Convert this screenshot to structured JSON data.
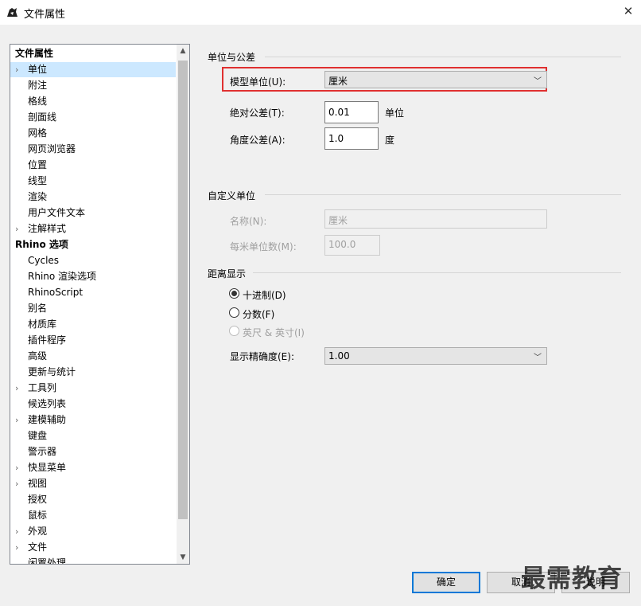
{
  "window": {
    "title": "文件属性",
    "close_glyph": "✕"
  },
  "tree": {
    "items": [
      {
        "label": "文件属性",
        "bold": true,
        "level": 0,
        "expander": false
      },
      {
        "label": "单位",
        "level": 1,
        "expander": true,
        "selected": true
      },
      {
        "label": "附注",
        "level": 1,
        "expander": false
      },
      {
        "label": "格线",
        "level": 1,
        "expander": false
      },
      {
        "label": "剖面线",
        "level": 1,
        "expander": false
      },
      {
        "label": "网格",
        "level": 1,
        "expander": false
      },
      {
        "label": "网页浏览器",
        "level": 1,
        "expander": false
      },
      {
        "label": "位置",
        "level": 1,
        "expander": false
      },
      {
        "label": "线型",
        "level": 1,
        "expander": false
      },
      {
        "label": "渲染",
        "level": 1,
        "expander": false
      },
      {
        "label": "用户文件文本",
        "level": 1,
        "expander": false
      },
      {
        "label": "注解样式",
        "level": 1,
        "expander": true
      },
      {
        "label": "Rhino 选项",
        "bold": true,
        "level": 0,
        "expander": false
      },
      {
        "label": "Cycles",
        "level": 1,
        "expander": false
      },
      {
        "label": "Rhino 渲染选项",
        "level": 1,
        "expander": false
      },
      {
        "label": "RhinoScript",
        "level": 1,
        "expander": false
      },
      {
        "label": "别名",
        "level": 1,
        "expander": false
      },
      {
        "label": "材质库",
        "level": 1,
        "expander": false
      },
      {
        "label": "插件程序",
        "level": 1,
        "expander": false
      },
      {
        "label": "高级",
        "level": 1,
        "expander": false
      },
      {
        "label": "更新与统计",
        "level": 1,
        "expander": false
      },
      {
        "label": "工具列",
        "level": 1,
        "expander": true
      },
      {
        "label": "候选列表",
        "level": 1,
        "expander": false
      },
      {
        "label": "建模辅助",
        "level": 1,
        "expander": true
      },
      {
        "label": "键盘",
        "level": 1,
        "expander": false
      },
      {
        "label": "警示器",
        "level": 1,
        "expander": false
      },
      {
        "label": "快显菜单",
        "level": 1,
        "expander": true
      },
      {
        "label": "视图",
        "level": 1,
        "expander": true
      },
      {
        "label": "授权",
        "level": 1,
        "expander": false
      },
      {
        "label": "鼠标",
        "level": 1,
        "expander": false
      },
      {
        "label": "外观",
        "level": 1,
        "expander": true
      },
      {
        "label": "文件",
        "level": 1,
        "expander": true
      },
      {
        "label": "闲置处理",
        "level": 1,
        "expander": false
      }
    ]
  },
  "units_tolerances": {
    "section_title": "单位与公差",
    "model_units_label": "模型单位(U):",
    "model_units_value": "厘米",
    "abs_tol_label": "绝对公差(T):",
    "abs_tol_value": "0.01",
    "abs_tol_unit": "单位",
    "angle_tol_label": "角度公差(A):",
    "angle_tol_value": "1.0",
    "angle_tol_unit": "度"
  },
  "custom_units": {
    "section_title": "自定义单位",
    "name_label": "名称(N):",
    "name_value": "厘米",
    "per_meter_label": "每米单位数(M):",
    "per_meter_value": "100.0"
  },
  "distance_display": {
    "section_title": "距离显示",
    "options": [
      {
        "label": "十进制(D)",
        "checked": true,
        "enabled": true
      },
      {
        "label": "分数(F)",
        "checked": false,
        "enabled": true
      },
      {
        "label": "英尺 & 英寸(I)",
        "checked": false,
        "enabled": false
      }
    ],
    "precision_label": "显示精确度(E):",
    "precision_value": "1.00"
  },
  "buttons": {
    "ok": "确定",
    "cancel": "取消",
    "help": "说明"
  },
  "watermark": "最需教育",
  "colors": {
    "highlight": "#e03030",
    "selection": "#cce8ff",
    "default_button_border": "#0078d7"
  }
}
